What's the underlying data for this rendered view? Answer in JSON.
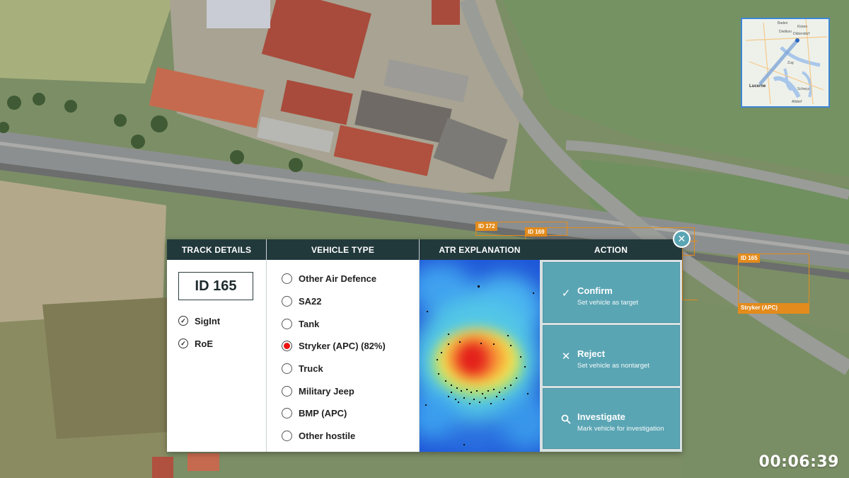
{
  "minimap": {
    "places": [
      "Baden",
      "Kloten",
      "Dietikon",
      "Dübendorf",
      "Zug",
      "Lucerne",
      "Schwyz",
      "Altdorf"
    ]
  },
  "detections": [
    {
      "label": "ID 172"
    },
    {
      "label": "ID 169"
    },
    {
      "label": "ID 165",
      "class": "Stryker (APC)"
    }
  ],
  "panel": {
    "headers": {
      "track": "TRACK DETAILS",
      "vehicle": "VEHICLE TYPE",
      "atr": "ATR EXPLANATION",
      "action": "ACTION"
    },
    "track_id": "ID 165",
    "checks": [
      {
        "label": "SigInt",
        "icon": "check-circle-icon"
      },
      {
        "label": "RoE",
        "icon": "check-circle-icon"
      }
    ],
    "vehicle_types": [
      {
        "label": "Other Air Defence",
        "selected": false
      },
      {
        "label": "SA22",
        "selected": false
      },
      {
        "label": "Tank",
        "selected": false
      },
      {
        "label": "Stryker (APC) (82%)",
        "selected": true
      },
      {
        "label": "Truck",
        "selected": false
      },
      {
        "label": "Military Jeep",
        "selected": false
      },
      {
        "label": "BMP (APC)",
        "selected": false
      },
      {
        "label": "Other hostile",
        "selected": false
      }
    ],
    "actions": [
      {
        "title": "Confirm",
        "subtitle": "Set vehicle as target",
        "icon": "check-icon"
      },
      {
        "title": "Reject",
        "subtitle": "Set vehicle as nontarget",
        "icon": "x-icon"
      },
      {
        "title": "Investigate",
        "subtitle": "Mark vehicle for investigation",
        "icon": "magnifier-icon"
      }
    ]
  },
  "close_icon": "close-icon",
  "timer": "00:06:39",
  "colors": {
    "panel_header": "#22393c",
    "action_button": "#5aa5b4",
    "detection": "#e38b1c",
    "radio_selected": "#ee1111"
  }
}
